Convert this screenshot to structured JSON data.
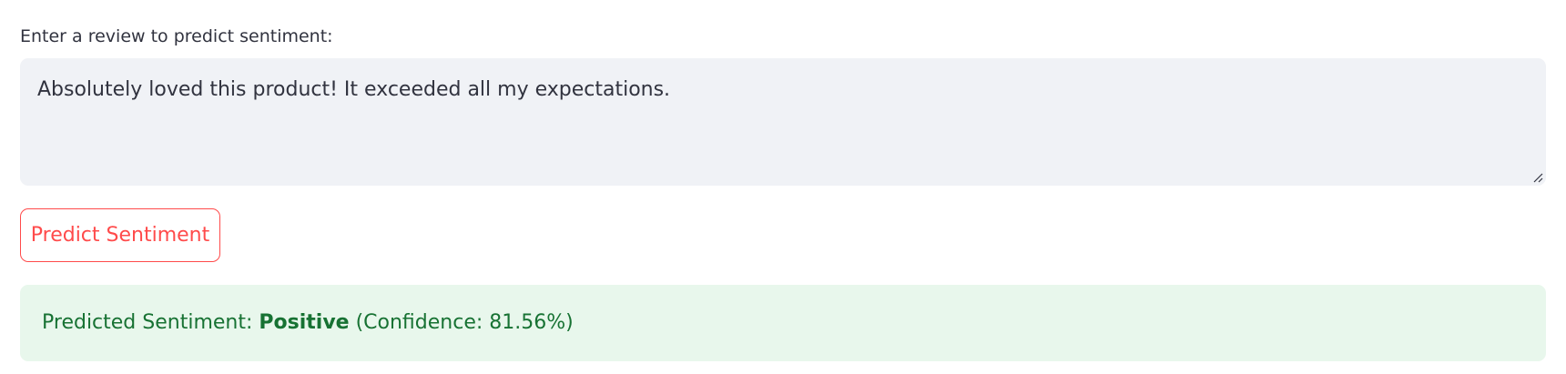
{
  "input": {
    "label": "Enter a review to predict sentiment:",
    "value": "Absolutely loved this product! It exceeded all my expectations."
  },
  "button": {
    "label": "Predict Sentiment"
  },
  "result": {
    "prefix": "Predicted Sentiment: ",
    "sentiment": "Positive",
    "confidence_text": " (Confidence: 81.56%)"
  },
  "colors": {
    "accent": "#ff4b4b",
    "input_bg": "#f0f2f6",
    "success_bg": "#e8f7ec",
    "success_text": "#177233",
    "text": "#31333f"
  }
}
